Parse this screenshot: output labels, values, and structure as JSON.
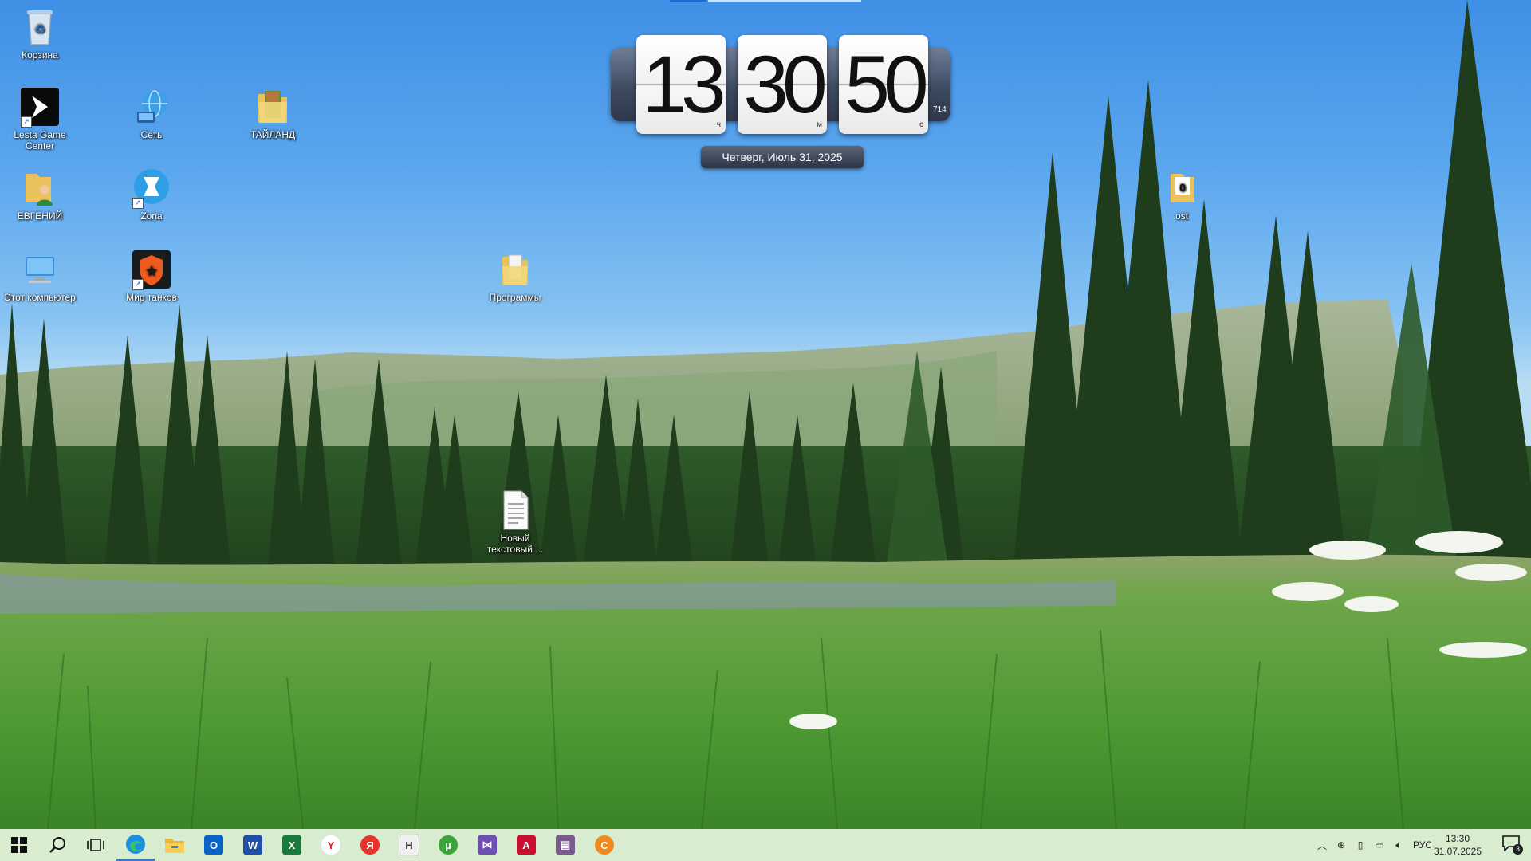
{
  "desktop": {
    "icons": [
      {
        "label": "Корзина"
      },
      {
        "label": "Lesta Game Center"
      },
      {
        "label": "Сеть"
      },
      {
        "label": "ТАЙЛАНД"
      },
      {
        "label": "ЕВГЕНИЙ"
      },
      {
        "label": "Zona"
      },
      {
        "label": "Этот компьютер"
      },
      {
        "label": "Мир танков"
      },
      {
        "label": "Программы"
      },
      {
        "label": "Новый текстовый ..."
      },
      {
        "label": "ost"
      }
    ]
  },
  "clock_widget": {
    "hours": "13",
    "minutes": "30",
    "seconds": "50",
    "hours_unit": "ч",
    "minutes_unit": "м",
    "seconds_unit": "с",
    "extra": "714",
    "date": "Четверг, Июль 31, 2025"
  },
  "taskbar": {
    "apps": [
      {
        "name": "start",
        "icon": "windows-logo-icon"
      },
      {
        "name": "search",
        "icon": "search-icon"
      },
      {
        "name": "task-view",
        "icon": "task-view-icon"
      },
      {
        "name": "edge",
        "icon": "edge-icon"
      },
      {
        "name": "file-explorer",
        "icon": "folder-icon"
      },
      {
        "name": "outlook",
        "icon": "outlook-icon",
        "glyph": "O"
      },
      {
        "name": "word",
        "icon": "word-icon",
        "glyph": "W"
      },
      {
        "name": "excel",
        "icon": "excel-icon",
        "glyph": "X"
      },
      {
        "name": "yandex-browser",
        "icon": "yandex-browser-icon",
        "glyph": "Y"
      },
      {
        "name": "yandex",
        "icon": "yandex-icon",
        "glyph": "Я"
      },
      {
        "name": "h-app",
        "icon": "h-app-icon",
        "glyph": "H"
      },
      {
        "name": "utorrent",
        "icon": "utorrent-icon",
        "glyph": "µ"
      },
      {
        "name": "visual-studio",
        "icon": "visual-studio-icon",
        "glyph": "⋈"
      },
      {
        "name": "acrobat",
        "icon": "acrobat-icon",
        "glyph": "A"
      },
      {
        "name": "archiver",
        "icon": "archiver-icon",
        "glyph": "▤"
      },
      {
        "name": "chromium-app",
        "icon": "orange-app-icon",
        "glyph": "C"
      }
    ],
    "tray": {
      "language": "РУС",
      "time": "13:30",
      "date": "31.07.2025",
      "notifications_count": "3"
    }
  },
  "colors": {
    "taskbar_bg": "#d8ecd0",
    "accent": "#3a7bd5"
  }
}
